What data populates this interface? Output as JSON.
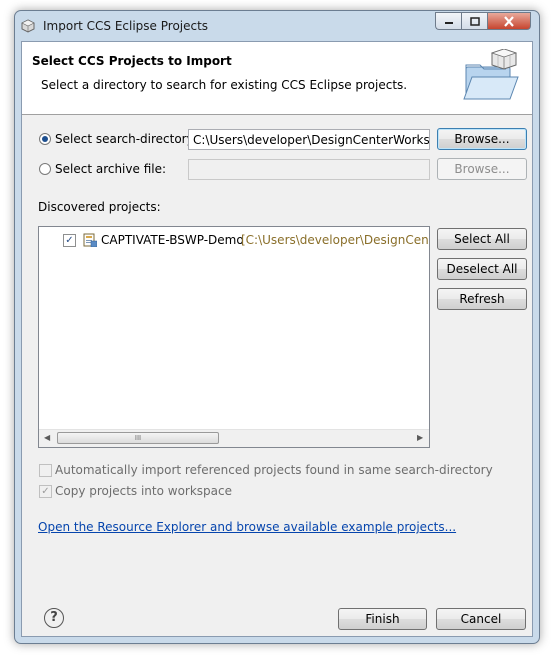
{
  "window": {
    "title": "Import CCS Eclipse Projects"
  },
  "banner": {
    "title": "Select CCS Projects to Import",
    "description": "Select a directory to search for existing CCS Eclipse projects."
  },
  "source": {
    "search_directory_label": "Select search-directory:",
    "search_directory_value": "C:\\Users\\developer\\DesignCenterWorkspace",
    "search_browse_label": "Browse...",
    "archive_label": "Select archive file:",
    "archive_value": "",
    "archive_browse_label": "Browse...",
    "selected": "search-directory"
  },
  "discovered": {
    "label": "Discovered projects:",
    "projects": [
      {
        "name": "CAPTIVATE-BSWP-Demo",
        "path": "[C:\\Users\\developer\\DesignCenterWorkspace\\CAPTIVATE-BSWP-Demo]",
        "checked": true
      }
    ],
    "scroll_grip": "III",
    "select_all_label": "Select All",
    "deselect_all_label": "Deselect All",
    "refresh_label": "Refresh"
  },
  "options": {
    "auto_import_label": "Automatically import referenced projects found in same search-directory",
    "auto_import_checked": false,
    "copy_label": "Copy projects into workspace",
    "copy_checked": true
  },
  "link_text": "Open the Resource Explorer and browse available example projects...",
  "footer": {
    "help_glyph": "?",
    "finish_label": "Finish",
    "cancel_label": "Cancel"
  },
  "colors": {
    "link": "#0645ad",
    "path": "#8a6f2a",
    "accent": "#3c7fb1"
  }
}
